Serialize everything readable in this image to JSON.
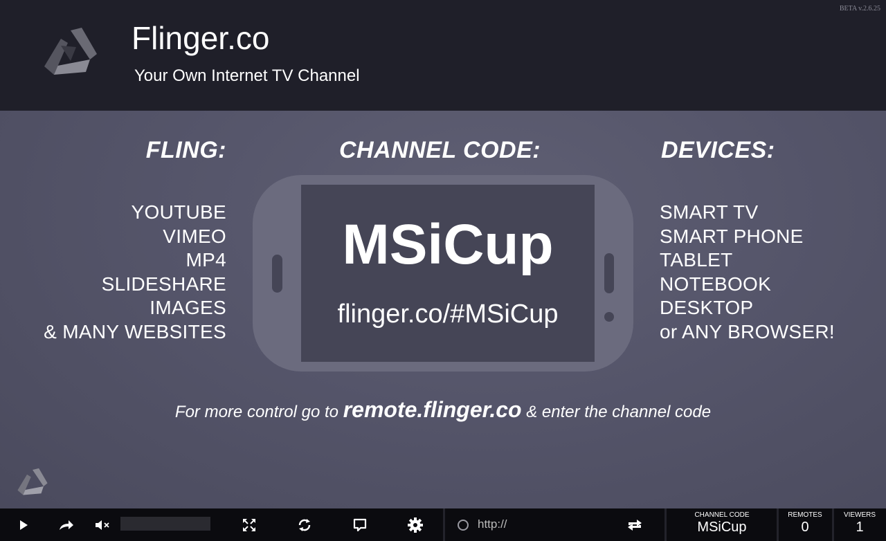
{
  "header": {
    "title": "Flinger.co",
    "subtitle": "Your Own Internet TV Channel",
    "version": "BETA v.2.6.25"
  },
  "fling": {
    "heading": "FLING:",
    "items": [
      "YOUTUBE",
      "VIMEO",
      "MP4",
      "SLIDESHARE",
      "IMAGES",
      "& MANY WEBSITES"
    ]
  },
  "channel": {
    "heading": "CHANNEL CODE:",
    "code": "MSiCup",
    "url": "flinger.co/#MSiCup"
  },
  "devices": {
    "heading": "DEVICES:",
    "items": [
      "SMART TV",
      "SMART PHONE",
      "TABLET",
      "NOTEBOOK",
      "DESKTOP",
      "or ANY BROWSER!"
    ]
  },
  "hint": {
    "prefix": "For more control go to",
    "link": "remote.flinger.co",
    "suffix": "& enter the channel code"
  },
  "toolbar": {
    "icons": [
      "play-icon",
      "forward-icon",
      "mute-icon",
      "fullscreen-icon",
      "refresh-icon",
      "chat-icon",
      "gear-icon",
      "fling-url-icon"
    ],
    "url_placeholder": "http://",
    "channel_code_label": "CHANNEL CODE",
    "channel_code_value": "MSiCup",
    "remotes_label": "REMOTES",
    "remotes_value": "0",
    "viewers_label": "VIEWERS",
    "viewers_value": "1"
  },
  "colors": {
    "header_bg": "#1f1f29",
    "main_bg": "#55556a",
    "phone": "#6b6b7e",
    "phone_screen": "#454556",
    "toolbar_bg": "#0b0b0f"
  }
}
